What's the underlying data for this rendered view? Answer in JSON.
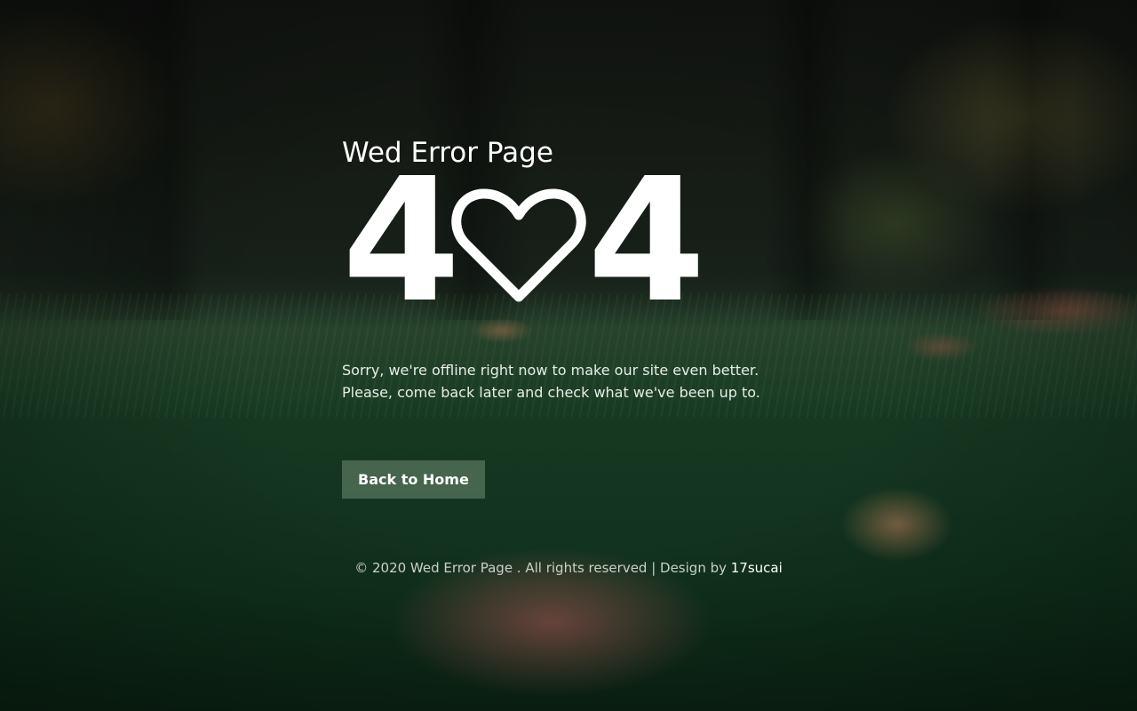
{
  "header": {
    "site_title": "Wed Error Page"
  },
  "error": {
    "code_first_digit": "4",
    "code_last_digit": "4",
    "middle_icon": "heart-icon"
  },
  "message": {
    "line1": "Sorry, we're offline right now to make our site even better.",
    "line2": "Please, come back later and check what we've been up to."
  },
  "actions": {
    "home_label": "Back to Home"
  },
  "footer": {
    "copyright_text": "© 2020 Wed Error Page . All rights reserved | Design by ",
    "designer_link": "17sucai"
  },
  "colors": {
    "text": "#ffffff",
    "button_bg": "#5a7a60"
  }
}
